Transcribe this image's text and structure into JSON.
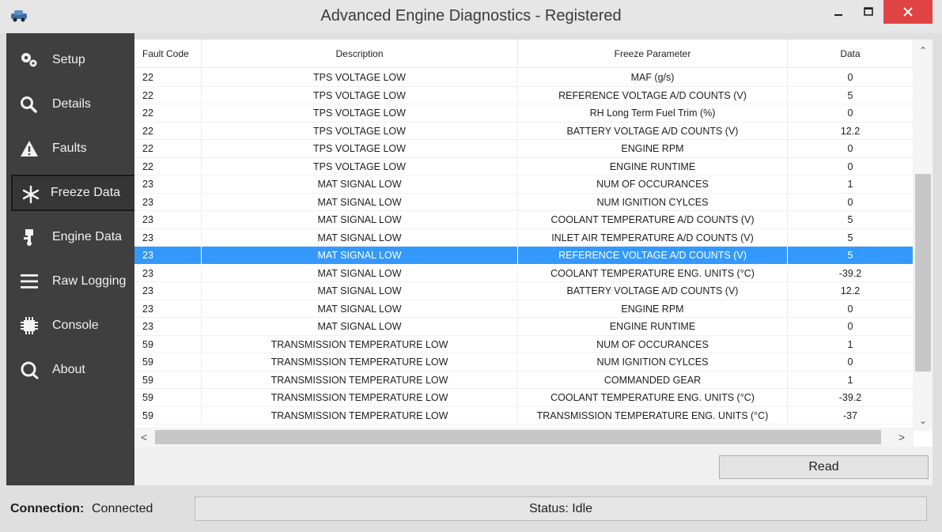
{
  "window": {
    "title": "Advanced Engine Diagnostics - Registered",
    "minimize_glyph": "–",
    "maximize_glyph": "□",
    "close_glyph": "✕",
    "close_color": "#e04343"
  },
  "sidebar": {
    "items": [
      {
        "label": "Setup",
        "icon": "gears-icon"
      },
      {
        "label": "Details",
        "icon": "magnifier-icon"
      },
      {
        "label": "Faults",
        "icon": "warning-icon"
      },
      {
        "label": "Freeze Data",
        "icon": "snowflake-icon",
        "active": true
      },
      {
        "label": "Engine Data",
        "icon": "engine-icon"
      },
      {
        "label": "Raw Logging",
        "icon": "hamburger-icon"
      },
      {
        "label": "Console",
        "icon": "chip-icon"
      },
      {
        "label": "About",
        "icon": "chat-icon"
      }
    ]
  },
  "grid": {
    "columns": [
      "Fault Code",
      "Description",
      "Freeze Parameter",
      "Data"
    ],
    "selected_row": 10,
    "selection_color": "#3399ff",
    "rows": [
      [
        "22",
        "TPS VOLTAGE LOW",
        "MAF (g/s)",
        "0"
      ],
      [
        "22",
        "TPS VOLTAGE LOW",
        "REFERENCE VOLTAGE A/D COUNTS (V)",
        "5"
      ],
      [
        "22",
        "TPS VOLTAGE LOW",
        "RH Long Term Fuel Trim (%)",
        "0"
      ],
      [
        "22",
        "TPS VOLTAGE LOW",
        "BATTERY VOLTAGE A/D COUNTS (V)",
        "12.2"
      ],
      [
        "22",
        "TPS VOLTAGE LOW",
        "ENGINE RPM",
        "0"
      ],
      [
        "22",
        "TPS VOLTAGE LOW",
        "ENGINE RUNTIME",
        "0"
      ],
      [
        "23",
        "MAT SIGNAL LOW",
        "NUM OF OCCURANCES",
        "1"
      ],
      [
        "23",
        "MAT SIGNAL LOW",
        "NUM IGNITION CYLCES",
        "0"
      ],
      [
        "23",
        "MAT SIGNAL LOW",
        "COOLANT TEMPERATURE A/D COUNTS (V)",
        "5"
      ],
      [
        "23",
        "MAT SIGNAL LOW",
        "INLET AIR TEMPERATURE A/D COUNTS (V)",
        "5"
      ],
      [
        "23",
        "MAT SIGNAL LOW",
        "REFERENCE VOLTAGE A/D COUNTS (V)",
        "5"
      ],
      [
        "23",
        "MAT SIGNAL LOW",
        "COOLANT TEMPERATURE ENG. UNITS (°C)",
        "-39.2"
      ],
      [
        "23",
        "MAT SIGNAL LOW",
        "BATTERY VOLTAGE A/D COUNTS (V)",
        "12.2"
      ],
      [
        "23",
        "MAT SIGNAL LOW",
        "ENGINE RPM",
        "0"
      ],
      [
        "23",
        "MAT SIGNAL LOW",
        "ENGINE RUNTIME",
        "0"
      ],
      [
        "59",
        "TRANSMISSION TEMPERATURE LOW",
        "NUM OF OCCURANCES",
        "1"
      ],
      [
        "59",
        "TRANSMISSION TEMPERATURE LOW",
        "NUM IGNITION CYLCES",
        "0"
      ],
      [
        "59",
        "TRANSMISSION TEMPERATURE LOW",
        "COMMANDED GEAR",
        "1"
      ],
      [
        "59",
        "TRANSMISSION TEMPERATURE LOW",
        "COOLANT TEMPERATURE ENG. UNITS (°C)",
        "-39.2"
      ],
      [
        "59",
        "TRANSMISSION TEMPERATURE LOW",
        "TRANSMISSION TEMPERATURE ENG. UNITS (°C)",
        "-37"
      ]
    ],
    "scroll_up_glyph": "⌃",
    "scroll_down_glyph": "⌄",
    "scroll_left_glyph": "<",
    "scroll_right_glyph": ">"
  },
  "actions": {
    "read_label": "Read"
  },
  "statusbar": {
    "connection_label": "Connection:",
    "connection_value": "Connected",
    "status_text": "Status: Idle"
  }
}
